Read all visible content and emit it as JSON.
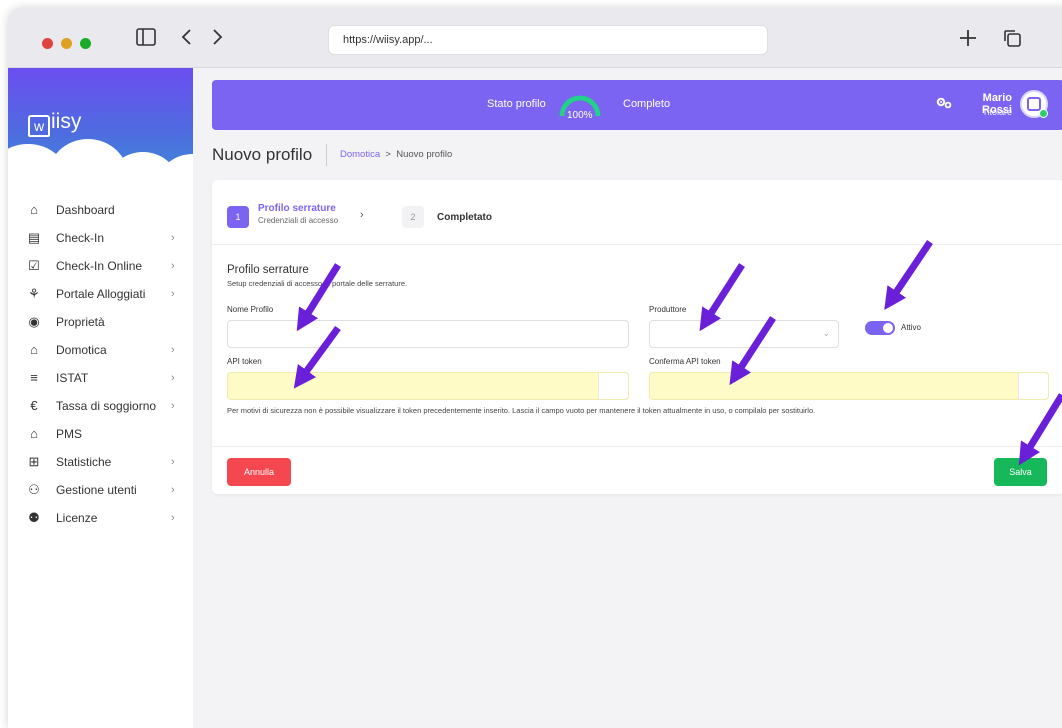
{
  "browser": {
    "url": "https://wiisy.app/...",
    "icons": [
      "sidebar-toggle-icon",
      "back-icon",
      "forward-icon",
      "new-tab-icon",
      "tabs-icon"
    ]
  },
  "sidebar": {
    "logo": "iisy",
    "logo_mark": "w",
    "items": [
      {
        "label": "Dashboard",
        "icon": "home-icon",
        "submenu": false
      },
      {
        "label": "Check-In",
        "icon": "book-icon",
        "submenu": true
      },
      {
        "label": "Check-In Online",
        "icon": "calendar-check-icon",
        "submenu": true
      },
      {
        "label": "Portale Alloggiati",
        "icon": "map-users-icon",
        "submenu": true
      },
      {
        "label": "Proprietà",
        "icon": "location-pin-icon",
        "submenu": false
      },
      {
        "label": "Domotica",
        "icon": "smart-home-icon",
        "submenu": true
      },
      {
        "label": "ISTAT",
        "icon": "bar-chart-icon",
        "submenu": true
      },
      {
        "label": "Tassa di soggiorno",
        "icon": "euro-icon",
        "submenu": true
      },
      {
        "label": "PMS",
        "icon": "houses-icon",
        "submenu": false
      },
      {
        "label": "Statistiche",
        "icon": "table-icon",
        "submenu": true
      },
      {
        "label": "Gestione utenti",
        "icon": "users-icon",
        "submenu": true
      },
      {
        "label": "Licenze",
        "icon": "user-license-icon",
        "submenu": true
      }
    ]
  },
  "topbar": {
    "stato_label": "Stato profilo",
    "gauge_value": "100%",
    "gauge_fraction": 1.0,
    "status": "Completo",
    "user_name": "Mario Rossi",
    "user_role": "Titolare"
  },
  "page": {
    "title": "Nuovo profilo",
    "breadcrumb_link": "Domotica",
    "breadcrumb_sep": ">",
    "breadcrumb_current": "Nuovo profilo"
  },
  "wizard": {
    "step1": {
      "num": "1",
      "title": "Profilo serrature",
      "subtitle": "Credenziali di accesso"
    },
    "step2": {
      "num": "2",
      "title": "Completato"
    }
  },
  "form": {
    "section_title": "Profilo serrature",
    "section_subtitle": "Setup credenziali di accesso al portale delle serrature.",
    "nome_label": "Nome Profilo",
    "nome_value": "",
    "produttore_label": "Produttore",
    "produttore_value": "",
    "toggle_label": "Attivo",
    "toggle_on": true,
    "api_label": "API token",
    "api_value": "",
    "conferma_label": "Conferma API token",
    "conferma_value": "",
    "help_text": "Per motivi di sicurezza non è possibile visualizzare il token precedentemente inserito. Lascia il campo vuoto per mantenere il token attualmente in uso, o compilalo per sostituirlo.",
    "cancel_label": "Annulla",
    "save_label": "Salva"
  },
  "colors": {
    "accent": "#7c64f2",
    "save": "#16b85a",
    "cancel": "#f5474f",
    "highlight_input": "#fffbc6",
    "annotation_arrow": "#6a1fd8"
  }
}
